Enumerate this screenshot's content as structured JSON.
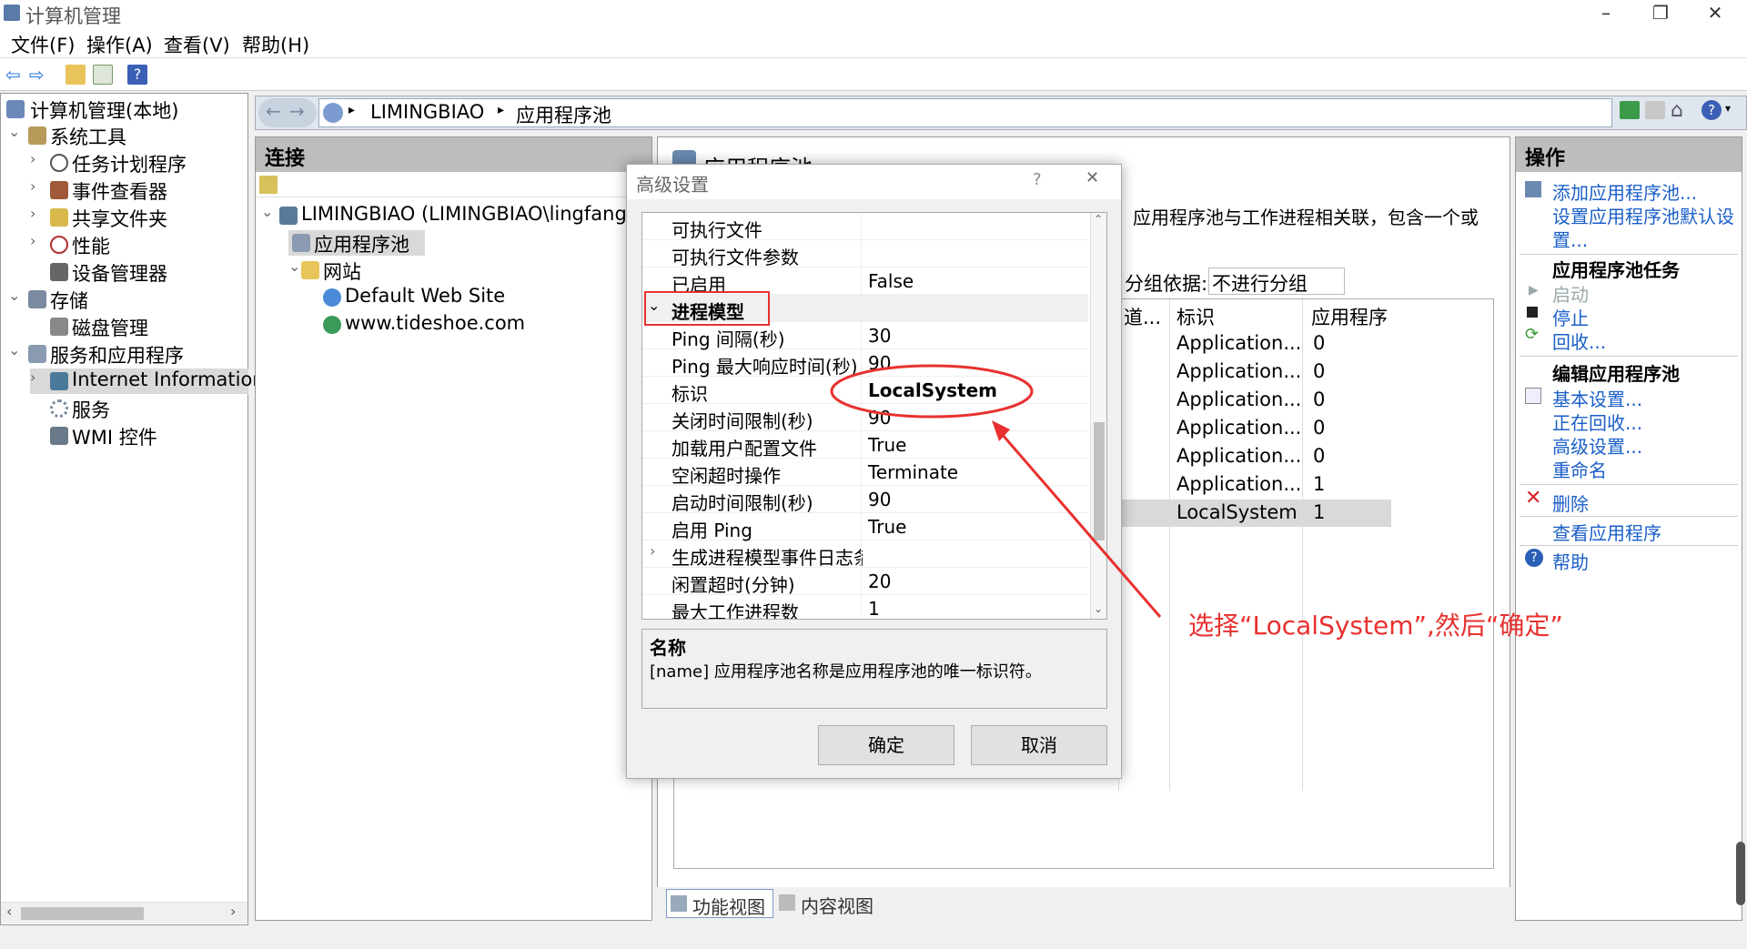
{
  "window": {
    "title": "计算机管理",
    "minimize": "–",
    "restore": "❐",
    "close": "✕"
  },
  "menu": [
    "文件(F)",
    "操作(A)",
    "查看(V)",
    "帮助(H)"
  ],
  "tree": {
    "root": "计算机管理(本地)",
    "items": [
      "系统工具",
      "任务计划程序",
      "事件查看器",
      "共享文件夹",
      "性能",
      "设备管理器",
      "存储",
      "磁盘管理",
      "服务和应用程序",
      "Internet Information",
      "服务",
      "WMI 控件"
    ]
  },
  "address": {
    "segments": [
      "LIMINGBIAO",
      "应用程序池"
    ]
  },
  "connections": {
    "title": "连接",
    "nodes": [
      "LIMINGBIAO (LIMINGBIAO\\lingfang)",
      "应用程序池",
      "网站",
      "Default Web Site",
      "www.tideshoe.com"
    ]
  },
  "center": {
    "title_partial": "应用程序池",
    "description": "应用程序池与工作进程相关联，包含一个或",
    "group_label": "分组依据:",
    "group_value": "不进行分组",
    "columns": [
      "道...",
      "标识",
      "应用程序"
    ],
    "rows": [
      [
        "Application...",
        "0"
      ],
      [
        "Application...",
        "0"
      ],
      [
        "Application...",
        "0"
      ],
      [
        "Application...",
        "0"
      ],
      [
        "Application...",
        "0"
      ],
      [
        "Application...",
        "1"
      ],
      [
        "LocalSystem",
        "1"
      ]
    ],
    "tabs": [
      "功能视图",
      "内容视图"
    ]
  },
  "actions": {
    "title": "操作",
    "add_pool": "添加应用程序池...",
    "set_defaults_l1": "设置应用程序池默认设",
    "set_defaults_l2": "置...",
    "tasks_header": "应用程序池任务",
    "start": "启动",
    "stop": "停止",
    "recycle": "回收...",
    "edit_header": "编辑应用程序池",
    "basic": "基本设置...",
    "recycling": "正在回收...",
    "advanced": "高级设置...",
    "rename": "重命名",
    "delete": "删除",
    "view_apps": "查看应用程序",
    "help": "帮助"
  },
  "dialog": {
    "title": "高级设置",
    "help": "?",
    "close": "✕",
    "props": [
      {
        "name": "可执行文件",
        "value": ""
      },
      {
        "name": "可执行文件参数",
        "value": ""
      },
      {
        "name": "已启用",
        "value": "False"
      },
      {
        "name": "Ping 间隔(秒)",
        "value": "30"
      },
      {
        "name": "Ping 最大响应时间(秒)",
        "value": "90"
      },
      {
        "name": "标识",
        "value": "LocalSystem"
      },
      {
        "name": "关闭时间限制(秒)",
        "value": "90"
      },
      {
        "name": "加载用户配置文件",
        "value": "True"
      },
      {
        "name": "空闲超时操作",
        "value": "Terminate"
      },
      {
        "name": "启动时间限制(秒)",
        "value": "90"
      },
      {
        "name": "启用 Ping",
        "value": "True"
      },
      {
        "name": "生成进程模型事件日志条",
        "value": ""
      },
      {
        "name": "闲置超时(分钟)",
        "value": "20"
      },
      {
        "name": "最大工作进程数",
        "value": "1"
      }
    ],
    "section": "进程模型",
    "desc_title": "名称",
    "desc_text": "[name] 应用程序池名称是应用程序池的唯一标识符。",
    "ok": "确定",
    "cancel": "取消"
  },
  "annotation": {
    "text": "选择“LocalSystem”,然后“确定”",
    "color": "#e8312f"
  }
}
